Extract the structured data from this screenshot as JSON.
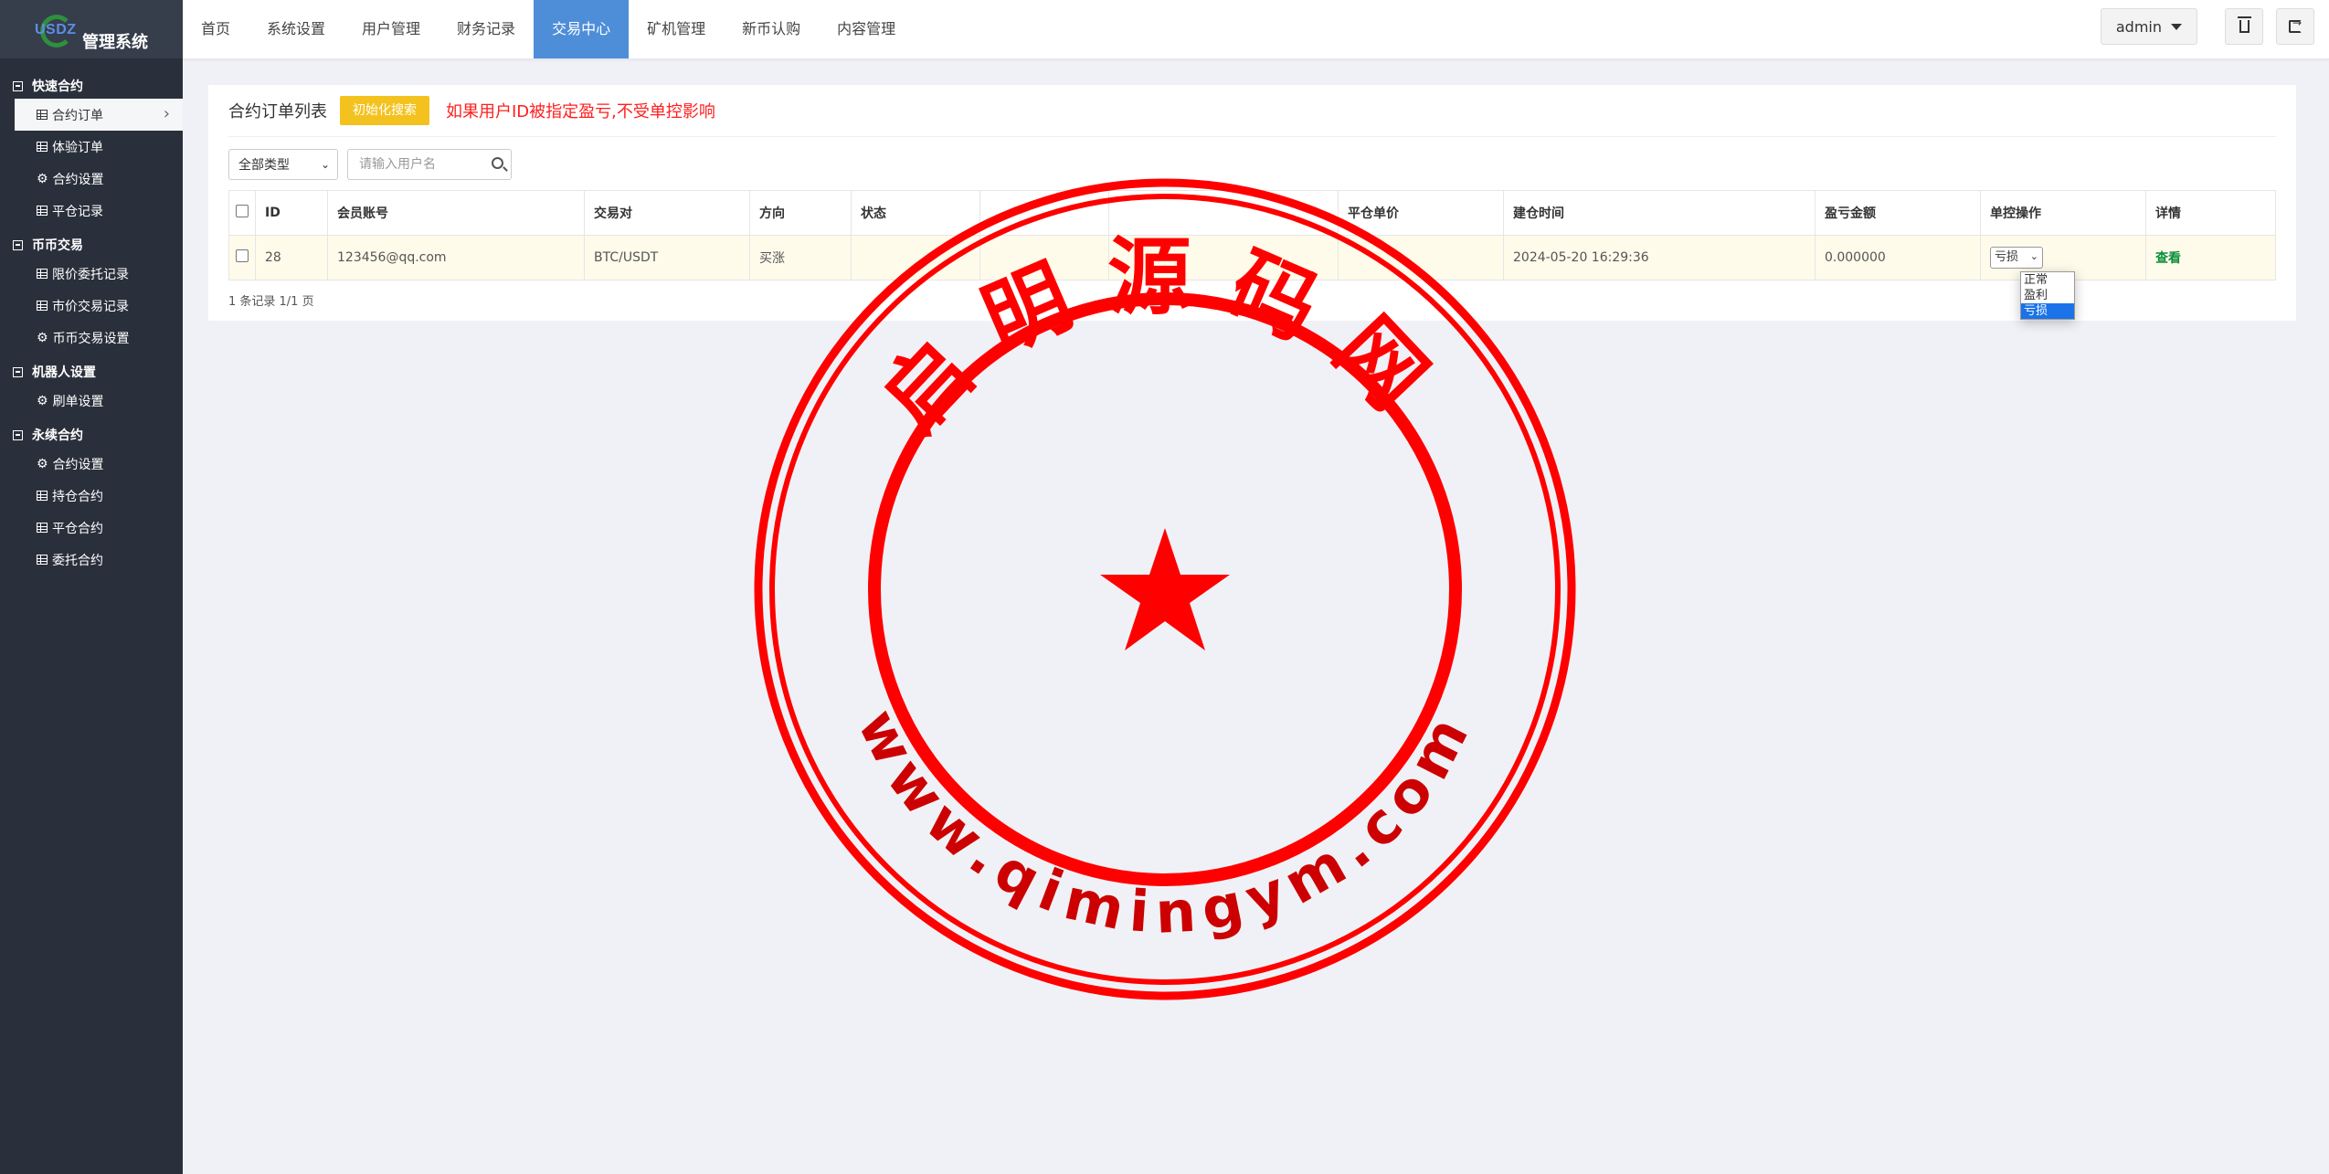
{
  "app": {
    "logo_text": "USDZ",
    "title": "管理系统"
  },
  "sidebar": {
    "groups": [
      {
        "title": "快速合约",
        "items": [
          {
            "label": "合约订单",
            "icon": "table-icon",
            "active": true
          },
          {
            "label": "体验订单",
            "icon": "table-icon"
          },
          {
            "label": "合约设置",
            "icon": "gear-icon"
          },
          {
            "label": "平仓记录",
            "icon": "table-icon"
          }
        ]
      },
      {
        "title": "币币交易",
        "items": [
          {
            "label": "限价委托记录",
            "icon": "table-icon"
          },
          {
            "label": "市价交易记录",
            "icon": "table-icon"
          },
          {
            "label": "币币交易设置",
            "icon": "gear-icon"
          }
        ]
      },
      {
        "title": "机器人设置",
        "items": [
          {
            "label": "刷单设置",
            "icon": "gear-icon"
          }
        ]
      },
      {
        "title": "永续合约",
        "items": [
          {
            "label": "合约设置",
            "icon": "gear-icon"
          },
          {
            "label": "持仓合约",
            "icon": "table-icon"
          },
          {
            "label": "平仓合约",
            "icon": "table-icon"
          },
          {
            "label": "委托合约",
            "icon": "table-icon"
          }
        ]
      }
    ]
  },
  "topnav": {
    "items": [
      "首页",
      "系统设置",
      "用户管理",
      "财务记录",
      "交易中心",
      "矿机管理",
      "新币认购",
      "内容管理"
    ],
    "active_index": 4,
    "user": "admin"
  },
  "panel": {
    "title": "合约订单列表",
    "reset_button": "初始化搜索",
    "warning": "如果用户ID被指定盈亏,不受单控影响",
    "type_filter": "全部类型",
    "search_placeholder": "请输入用户名"
  },
  "table": {
    "headers": [
      "ID",
      "会员账号",
      "交易对",
      "方向",
      "状态",
      "",
      "",
      "平仓单价",
      "建仓时间",
      "盈亏金额",
      "单控操作",
      "详情"
    ],
    "rows": [
      {
        "id": "28",
        "account": "123456@qq.com",
        "pair": "BTC/USDT",
        "direction": "买涨",
        "status": "",
        "col6": "",
        "col7": "",
        "close_price": "",
        "open_time": "2024-05-20 16:29:36",
        "pnl": "0.000000",
        "control": "亏损",
        "detail": "查看"
      }
    ],
    "control_options": [
      "正常",
      "盈利",
      "亏损"
    ],
    "selected_option_index": 2
  },
  "pager": "1 条记录 1/1 页",
  "stamp": {
    "top_text": "启明源码网",
    "bottom_text": "www.qimingym.com",
    "color": "#ff0000"
  },
  "colors": {
    "sidebar_bg": "#2a303b",
    "nav_active": "#4e8ed8",
    "reset_button": "#f4c21e",
    "warning": "#ff1e1e",
    "buy": "#2cb552"
  }
}
